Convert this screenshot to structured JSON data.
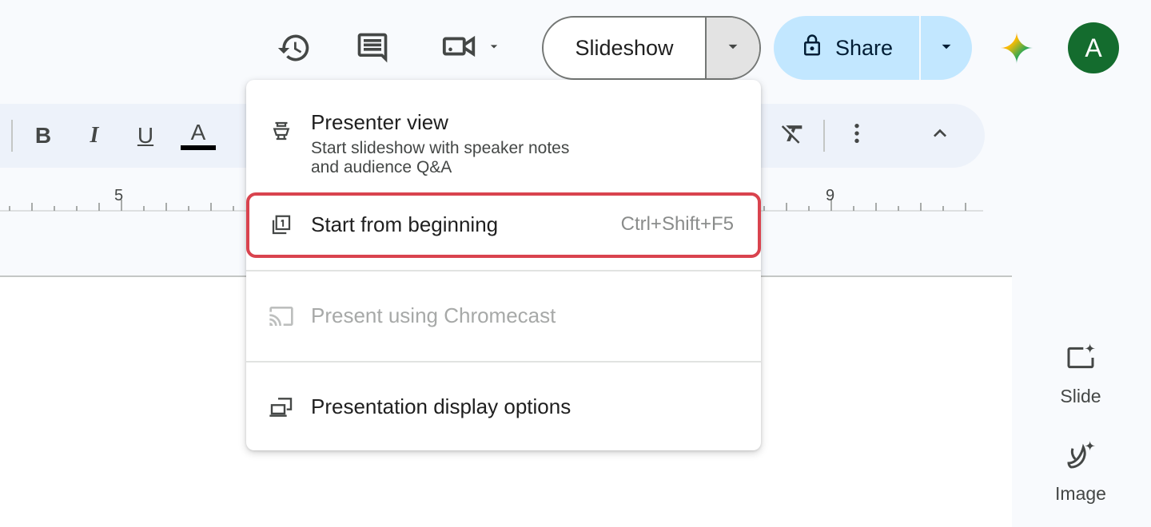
{
  "topbar": {
    "history_icon": "history-icon",
    "comments_icon": "comment-icon",
    "meet_icon": "video-camera-icon",
    "slideshow_label": "Slideshow",
    "share_label": "Share",
    "share_icon": "lock-icon",
    "gemini_icon": "gemini-sparkle-icon",
    "avatar_initial": "A",
    "avatar_color": "#146c2e",
    "share_color": "#c2e7ff"
  },
  "toolbar": {
    "bold": "B",
    "italic": "I",
    "underline": "U",
    "text_color": "A",
    "collapse_icon": "chevron-up-icon"
  },
  "ruler": {
    "numbers": [
      "5",
      "9"
    ]
  },
  "menu": {
    "items": [
      {
        "icon": "presenter-icon",
        "title": "Presenter view",
        "subtitle_line1": "Start slideshow with speaker notes",
        "subtitle_line2": "and audience Q&A"
      },
      {
        "icon": "slide-one-icon",
        "title": "Start from beginning",
        "shortcut": "Ctrl+Shift+F5"
      },
      {
        "icon": "cast-icon",
        "title": "Present using Chromecast",
        "disabled": true
      },
      {
        "icon": "display-options-icon",
        "title": "Presentation display options"
      }
    ],
    "highlight_color": "#d9434e"
  },
  "side_panel": {
    "items": [
      {
        "label": "Slide",
        "icon": "slide-sparkle-icon"
      },
      {
        "label": "Image",
        "icon": "banana-sparkle-icon"
      }
    ]
  }
}
